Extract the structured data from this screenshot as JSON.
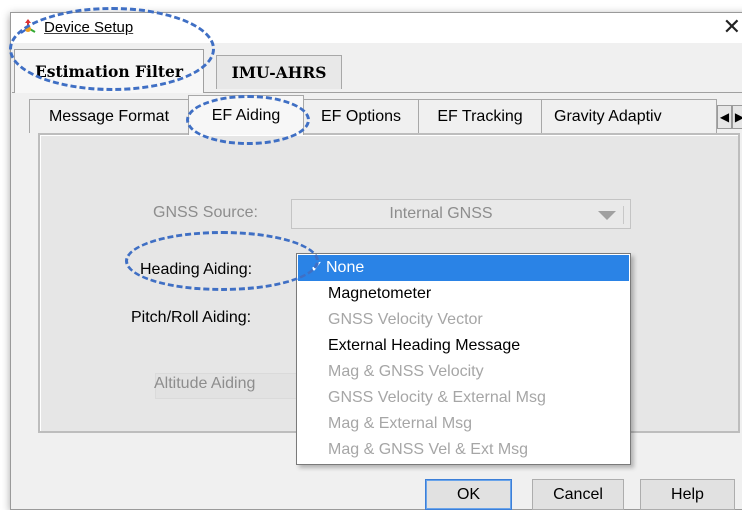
{
  "window": {
    "title": "Device Setup",
    "close_glyph": "✕"
  },
  "outer_tabs": [
    {
      "label": "Estimation Filter",
      "active": true
    },
    {
      "label": "IMU-AHRS",
      "active": false
    }
  ],
  "inner_tabs": [
    {
      "label": "Message Format",
      "active": false
    },
    {
      "label": "EF Aiding",
      "active": true
    },
    {
      "label": "EF Options",
      "active": false
    },
    {
      "label": "EF Tracking",
      "active": false
    },
    {
      "label": "Gravity Adaptiv",
      "active": false
    }
  ],
  "tab_scroll": {
    "left": "◀",
    "right": "▶"
  },
  "form": {
    "gnss_source_label": "GNSS Source:",
    "gnss_source_value": "Internal GNSS",
    "heading_aiding_label": "Heading Aiding:",
    "pitch_roll_label": "Pitch/Roll Aiding:",
    "altitude_label": "Altitude Aiding"
  },
  "dropdown": {
    "check": "✓",
    "options": [
      {
        "label": "None",
        "selected": true,
        "enabled": true
      },
      {
        "label": "Magnetometer",
        "selected": false,
        "enabled": true
      },
      {
        "label": "GNSS Velocity Vector",
        "selected": false,
        "enabled": false
      },
      {
        "label": "External Heading Message",
        "selected": false,
        "enabled": true
      },
      {
        "label": "Mag & GNSS Velocity",
        "selected": false,
        "enabled": false
      },
      {
        "label": "GNSS Velocity & External Msg",
        "selected": false,
        "enabled": false
      },
      {
        "label": "Mag & External Msg",
        "selected": false,
        "enabled": false
      },
      {
        "label": "Mag & GNSS Vel & Ext Msg",
        "selected": false,
        "enabled": false
      }
    ]
  },
  "buttons": {
    "ok": "OK",
    "cancel": "Cancel",
    "help": "Help"
  },
  "colors": {
    "selection": "#2a83e6",
    "highlight": "#3f6fc4",
    "disabled_text": "#8d8d8d"
  }
}
